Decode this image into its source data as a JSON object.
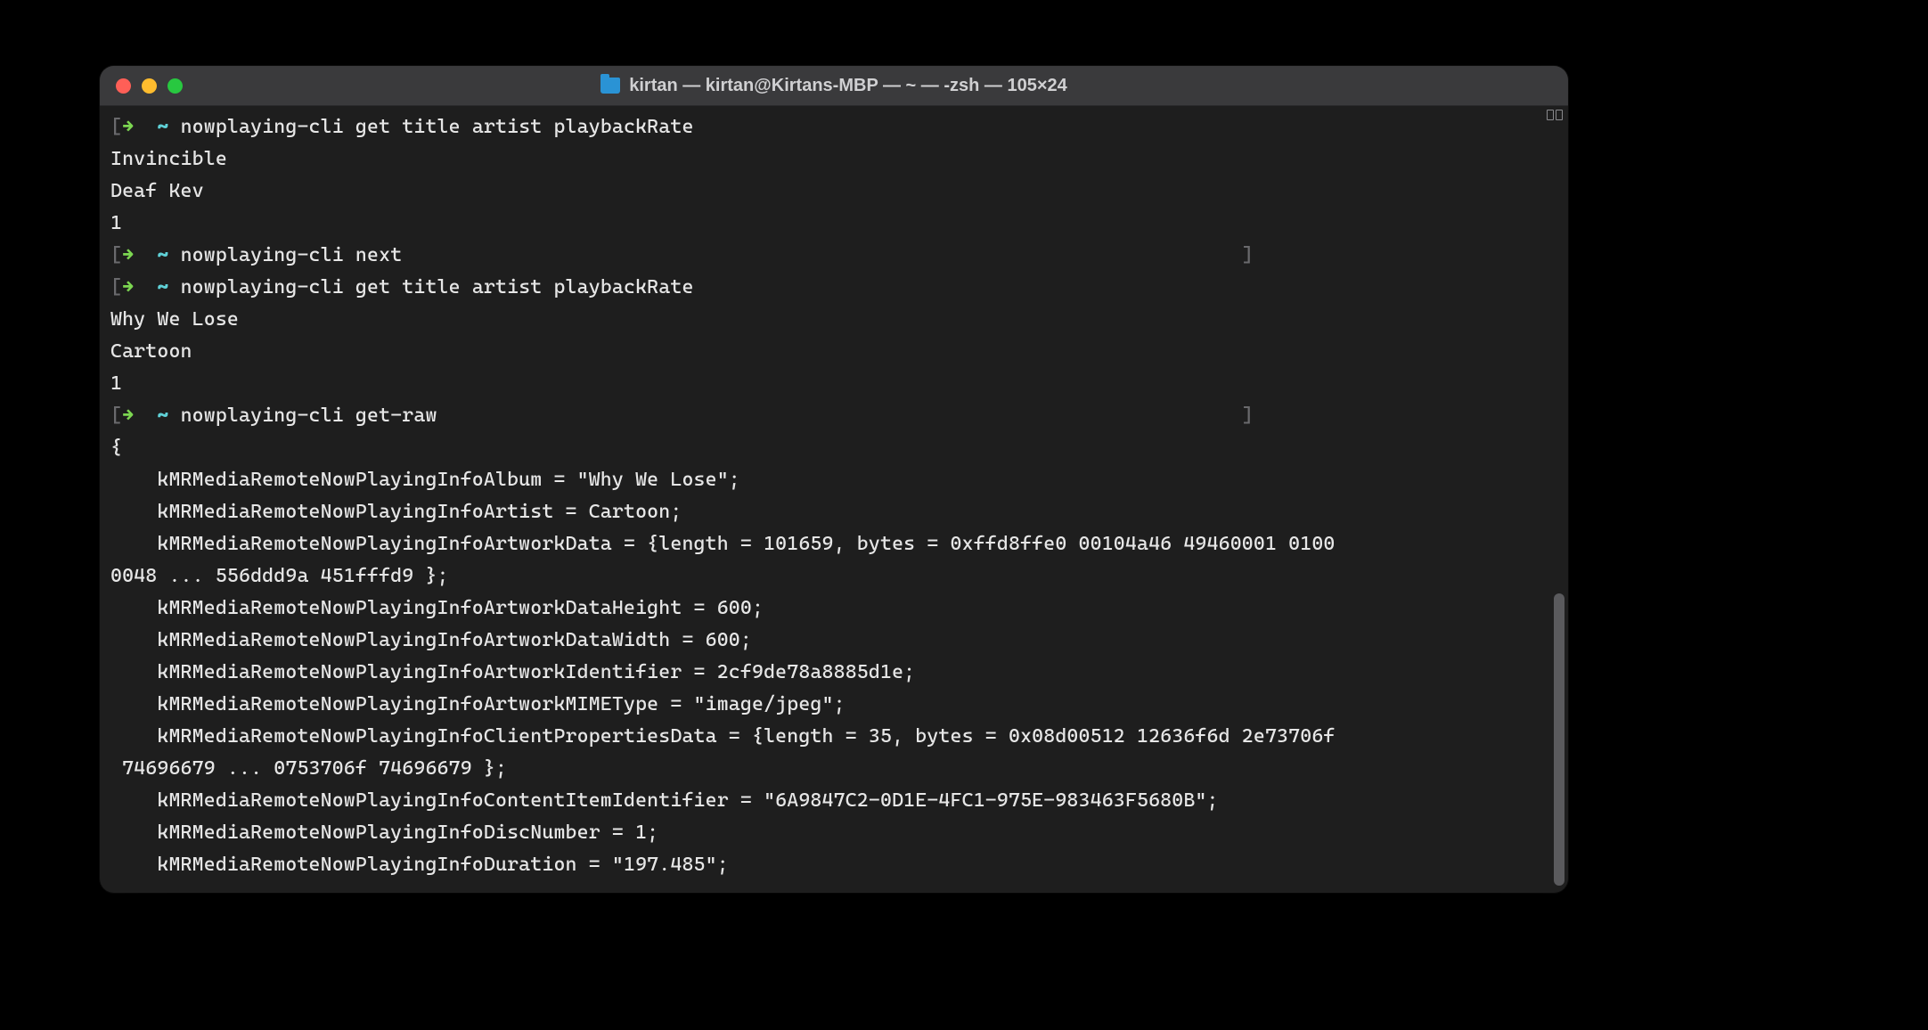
{
  "titlebar": {
    "title": "kirtan — kirtan@Kirtans-MBP — ~ — -zsh — 105×24"
  },
  "prompt": {
    "arrow": "→",
    "tilde": "~",
    "bracket_open": "[",
    "bracket_close": "]"
  },
  "lines": {
    "cmd1": "nowplaying-cli get title artist playbackRate",
    "out1a": "Invincible",
    "out1b": "Deaf Kev",
    "out1c": "1",
    "cmd2": "nowplaying-cli next",
    "cmd3": "nowplaying-cli get title artist playbackRate",
    "out3a": "Why We Lose",
    "out3b": "Cartoon",
    "out3c": "1",
    "cmd4": "nowplaying-cli get-raw",
    "raw_open": "{",
    "raw_album": "    kMRMediaRemoteNowPlayingInfoAlbum = \"Why We Lose\";",
    "raw_artist": "    kMRMediaRemoteNowPlayingInfoArtist = Cartoon;",
    "raw_artdata": "    kMRMediaRemoteNowPlayingInfoArtworkData = {length = 101659, bytes = 0xffd8ffe0 00104a46 49460001 0100",
    "raw_artdata2": "0048 ... 556ddd9a 451fffd9 };",
    "raw_h": "    kMRMediaRemoteNowPlayingInfoArtworkDataHeight = 600;",
    "raw_w": "    kMRMediaRemoteNowPlayingInfoArtworkDataWidth = 600;",
    "raw_artid": "    kMRMediaRemoteNowPlayingInfoArtworkIdentifier = 2cf9de78a8885d1e;",
    "raw_mime": "    kMRMediaRemoteNowPlayingInfoArtworkMIMEType = \"image/jpeg\";",
    "raw_cprop": "    kMRMediaRemoteNowPlayingInfoClientPropertiesData = {length = 35, bytes = 0x08d00512 12636f6d 2e73706f",
    "raw_cprop2": " 74696679 ... 0753706f 74696679 };",
    "raw_ciid": "    kMRMediaRemoteNowPlayingInfoContentItemIdentifier = \"6A9847C2-0D1E-4FC1-975E-983463F5680B\";",
    "raw_disc": "    kMRMediaRemoteNowPlayingInfoDiscNumber = 1;",
    "raw_dur": "    kMRMediaRemoteNowPlayingInfoDuration = \"197.485\";"
  }
}
